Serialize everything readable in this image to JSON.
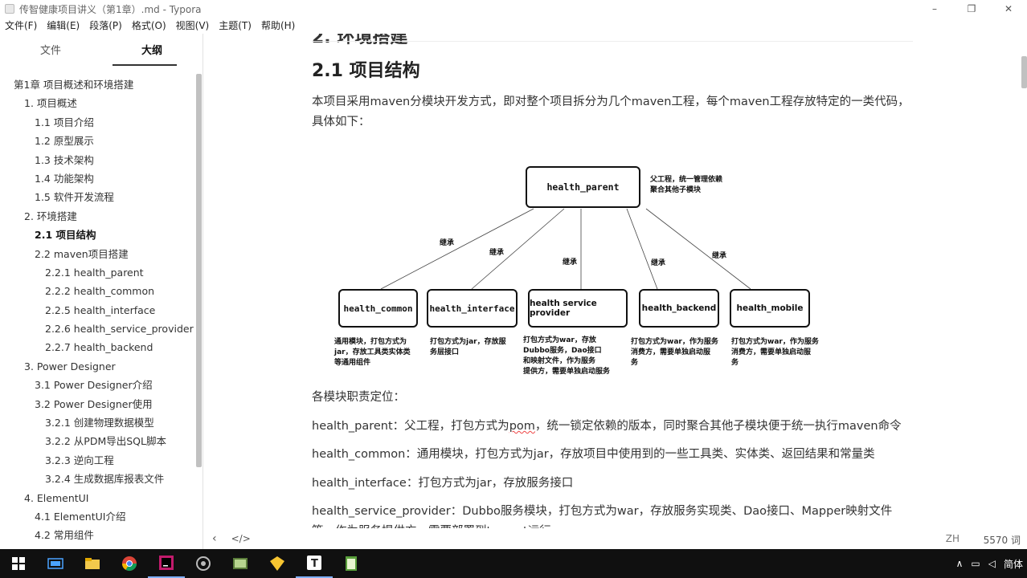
{
  "window": {
    "title": "传智健康项目讲义（第1章）.md - Typora"
  },
  "menu": [
    "文件(F)",
    "编辑(E)",
    "段落(P)",
    "格式(O)",
    "视图(V)",
    "主题(T)",
    "帮助(H)"
  ],
  "sidebar": {
    "tabs": [
      "文件",
      "大纲"
    ],
    "active_tab": "大纲",
    "outline": [
      {
        "label": "第1章 项目概述和环境搭建",
        "level": 1
      },
      {
        "label": "1. 项目概述",
        "level": 2
      },
      {
        "label": "1.1 项目介绍",
        "level": 3
      },
      {
        "label": "1.2 原型展示",
        "level": 3
      },
      {
        "label": "1.3 技术架构",
        "level": 3
      },
      {
        "label": "1.4 功能架构",
        "level": 3
      },
      {
        "label": "1.5 软件开发流程",
        "level": 3
      },
      {
        "label": "2. 环境搭建",
        "level": 2
      },
      {
        "label": "2.1 项目结构",
        "level": 3,
        "active": true
      },
      {
        "label": "2.2 maven项目搭建",
        "level": 3
      },
      {
        "label": "2.2.1 health_parent",
        "level": 4
      },
      {
        "label": "2.2.2 health_common",
        "level": 4
      },
      {
        "label": "2.2.5 health_interface",
        "level": 4
      },
      {
        "label": "2.2.6 health_service_provider",
        "level": 4
      },
      {
        "label": "2.2.7 health_backend",
        "level": 4
      },
      {
        "label": "3. Power Designer",
        "level": 2
      },
      {
        "label": "3.1 Power Designer介绍",
        "level": 3
      },
      {
        "label": "3.2 Power Designer使用",
        "level": 3
      },
      {
        "label": "3.2.1 创建物理数据模型",
        "level": 4
      },
      {
        "label": "3.2.2 从PDM导出SQL脚本",
        "level": 4
      },
      {
        "label": "3.2.3 逆向工程",
        "level": 4
      },
      {
        "label": "3.2.4 生成数据库报表文件",
        "level": 4
      },
      {
        "label": "4. ElementUI",
        "level": 2
      },
      {
        "label": "4.1 ElementUI介绍",
        "level": 3
      },
      {
        "label": "4.2 常用组件",
        "level": 3
      }
    ]
  },
  "editor": {
    "h2": "2.1 项目结构",
    "intro": "本项目采用maven分模块开发方式，即对整个项目拆分为几个maven工程，每个maven工程存放特定的一类代码，具体如下：",
    "duty_title": "各模块职责定位：",
    "lines": [
      {
        "prefix": "health_parent：父工程，打包方式为",
        "mark": "pom",
        "suffix": "，统一锁定依赖的版本，同时聚合其他子模块便于统一执行maven命令"
      },
      {
        "prefix": "health_common：通用模块，打包方式为jar，存放项目中使用到的一些工具类、实体类、返回结果和常量类",
        "mark": "",
        "suffix": ""
      },
      {
        "prefix": "health_interface：打包方式为jar，存放服务接口",
        "mark": "",
        "suffix": ""
      },
      {
        "prefix": "health_service_provider：Dubbo服务模块，打包方式为war，存放服务实现类、Dao接口、Mapper映射文件等，作为服务提供方，需要部署到tomcat运行",
        "mark": "",
        "suffix": ""
      }
    ],
    "status": {
      "lang": "ZH",
      "word_count": "5570 词"
    }
  },
  "diagram": {
    "parent": "health_parent",
    "parent_note": "父工程，统一管理依赖\n聚合其他子模块",
    "edge_label": "继承",
    "children": [
      {
        "label": "health_common",
        "note": "通用模块，打包方式为\njar，存放工具类实体类\n等通用组件"
      },
      {
        "label": "health_interface",
        "note": "打包方式为jar，存放服\n务层接口"
      },
      {
        "label": "health service provider",
        "note": "打包方式为war，存放\nDubbo服务，Dao接口\n和映射文件，作为服务\n提供方，需要单独启动服务"
      },
      {
        "label": "health_backend",
        "note": "打包方式为war，作为服务\n消费方，需要单独启动服\n务"
      },
      {
        "label": "health_mobile",
        "note": "打包方式为war，作为服务\n消费方，需要单独启动服\n务"
      }
    ]
  },
  "taskbar": {
    "ime": "简体"
  },
  "colors": {
    "accent": "#333333",
    "taskbar": "#101010",
    "spellcheck": "#ee4444"
  }
}
